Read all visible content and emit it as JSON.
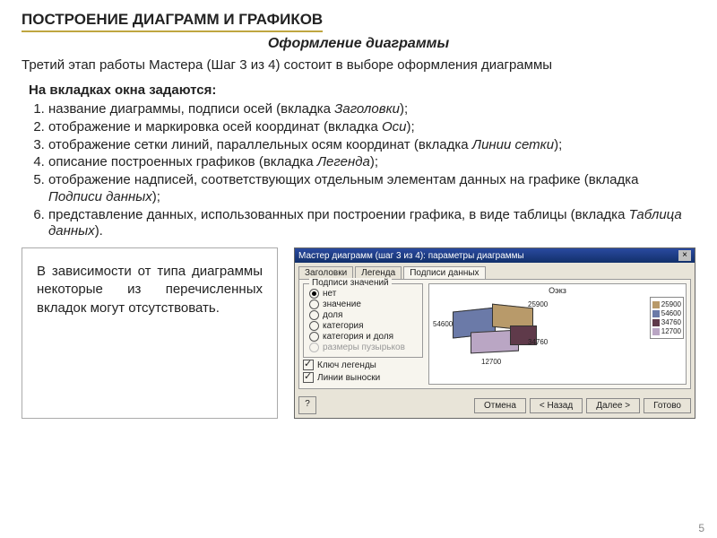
{
  "title": "ПОСТРОЕНИЕ  ДИАГРАММ И ГРАФИКОВ",
  "subtitle": "Оформление диаграммы",
  "intro": "Третий этап работы Мастера (Шаг 3 из 4) состоит в выборе оформления диаграммы",
  "list_header": "На вкладках окна задаются:",
  "items": {
    "i1a": "название диаграммы, подписи осей (вкладка ",
    "i1b": "Заголовки",
    "i1c": ");",
    "i2a": "отображение и маркировка осей координат (вкладка ",
    "i2b": "Оси",
    "i2c": ");",
    "i3a": "отображение сетки линий, параллельных осям координат (вкладка ",
    "i3b": "Линии сетки",
    "i3c": ");",
    "i4a": "описание построенных графиков (вкладка ",
    "i4b": "Легенда",
    "i4c": ");",
    "i5a": "отображение надписей, соответствующих отдельным элементам данных на графике (вкладка ",
    "i5b": "Подписи данных",
    "i5c": ");",
    "i6a": "представление данных, использованных при построении графика, в виде таблицы (вкладка ",
    "i6b": "Таблица данных",
    "i6c": ")."
  },
  "note": "В зависимости от типа диаграммы некоторые из перечисленных вкладок могут отсутствовать.",
  "dialog": {
    "title": "Мастер диаграмм (шаг 3 из 4): параметры диаграммы",
    "tabs": {
      "t1": "Заголовки",
      "t2": "Легенда",
      "t3": "Подписи данных"
    },
    "group": "Подписи значений",
    "opts": {
      "o1": "нет",
      "o2": "значение",
      "o3": "доля",
      "o4": "категория",
      "o5": "категория и доля",
      "o6": "размеры пузырьков"
    },
    "chk1": "Ключ легенды",
    "chk2": "Линии выноски",
    "preview_title": "Оэкз",
    "labels": {
      "a": "54600",
      "b": "25900",
      "c": "12700",
      "d": "34760"
    },
    "buttons": {
      "help": "?",
      "cancel": "Отмена",
      "back": "< Назад",
      "next": "Далее >",
      "finish": "Готово"
    }
  },
  "page_no": "5",
  "chart_data": {
    "type": "pie",
    "title": "Оэкз",
    "series": [
      {
        "name": "Оэкз",
        "values": [
          54600,
          25900,
          12700,
          34760
        ]
      }
    ],
    "categories": [
      "54600",
      "25900",
      "12700",
      "34760"
    ],
    "legend_entries": [
      "25900",
      "54600",
      "34760",
      "12700"
    ]
  }
}
